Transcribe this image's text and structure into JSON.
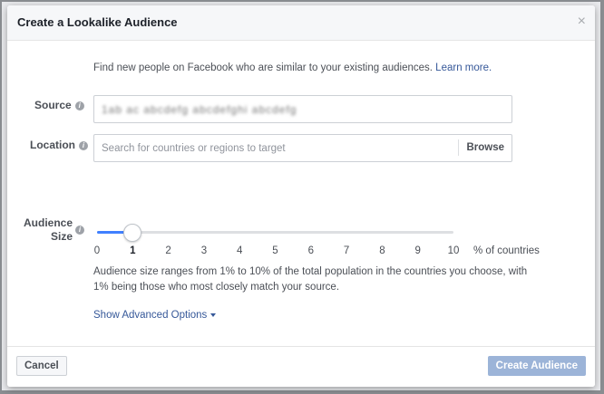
{
  "background": {
    "text": ""
  },
  "dialog": {
    "title": "Create a Lookalike Audience",
    "close_icon": "×",
    "intro": "Find new people on Facebook who are similar to your existing audiences.",
    "learn_more": "Learn more."
  },
  "source": {
    "label": "Source",
    "value": "1ab ac abcdefg abcdefghi abcdefg"
  },
  "location": {
    "label": "Location",
    "placeholder": "Search for countries or regions to target",
    "browse_label": "Browse"
  },
  "audience_size": {
    "label_line1": "Audience",
    "label_line2": "Size",
    "ticks": [
      "0",
      "1",
      "2",
      "3",
      "4",
      "5",
      "6",
      "7",
      "8",
      "9",
      "10"
    ],
    "selected": 1,
    "max": 10,
    "unit": "% of countries",
    "description": "Audience size ranges from 1% to 10% of the total population in the countries you choose, with 1% being those who most closely match your source.",
    "advanced_label": "Show Advanced Options"
  },
  "footer": {
    "cancel_label": "Cancel",
    "create_label": "Create Audience"
  },
  "colors": {
    "accent": "#4080ff",
    "link": "#365899",
    "create_button_disabled": "#9cb4d8"
  }
}
